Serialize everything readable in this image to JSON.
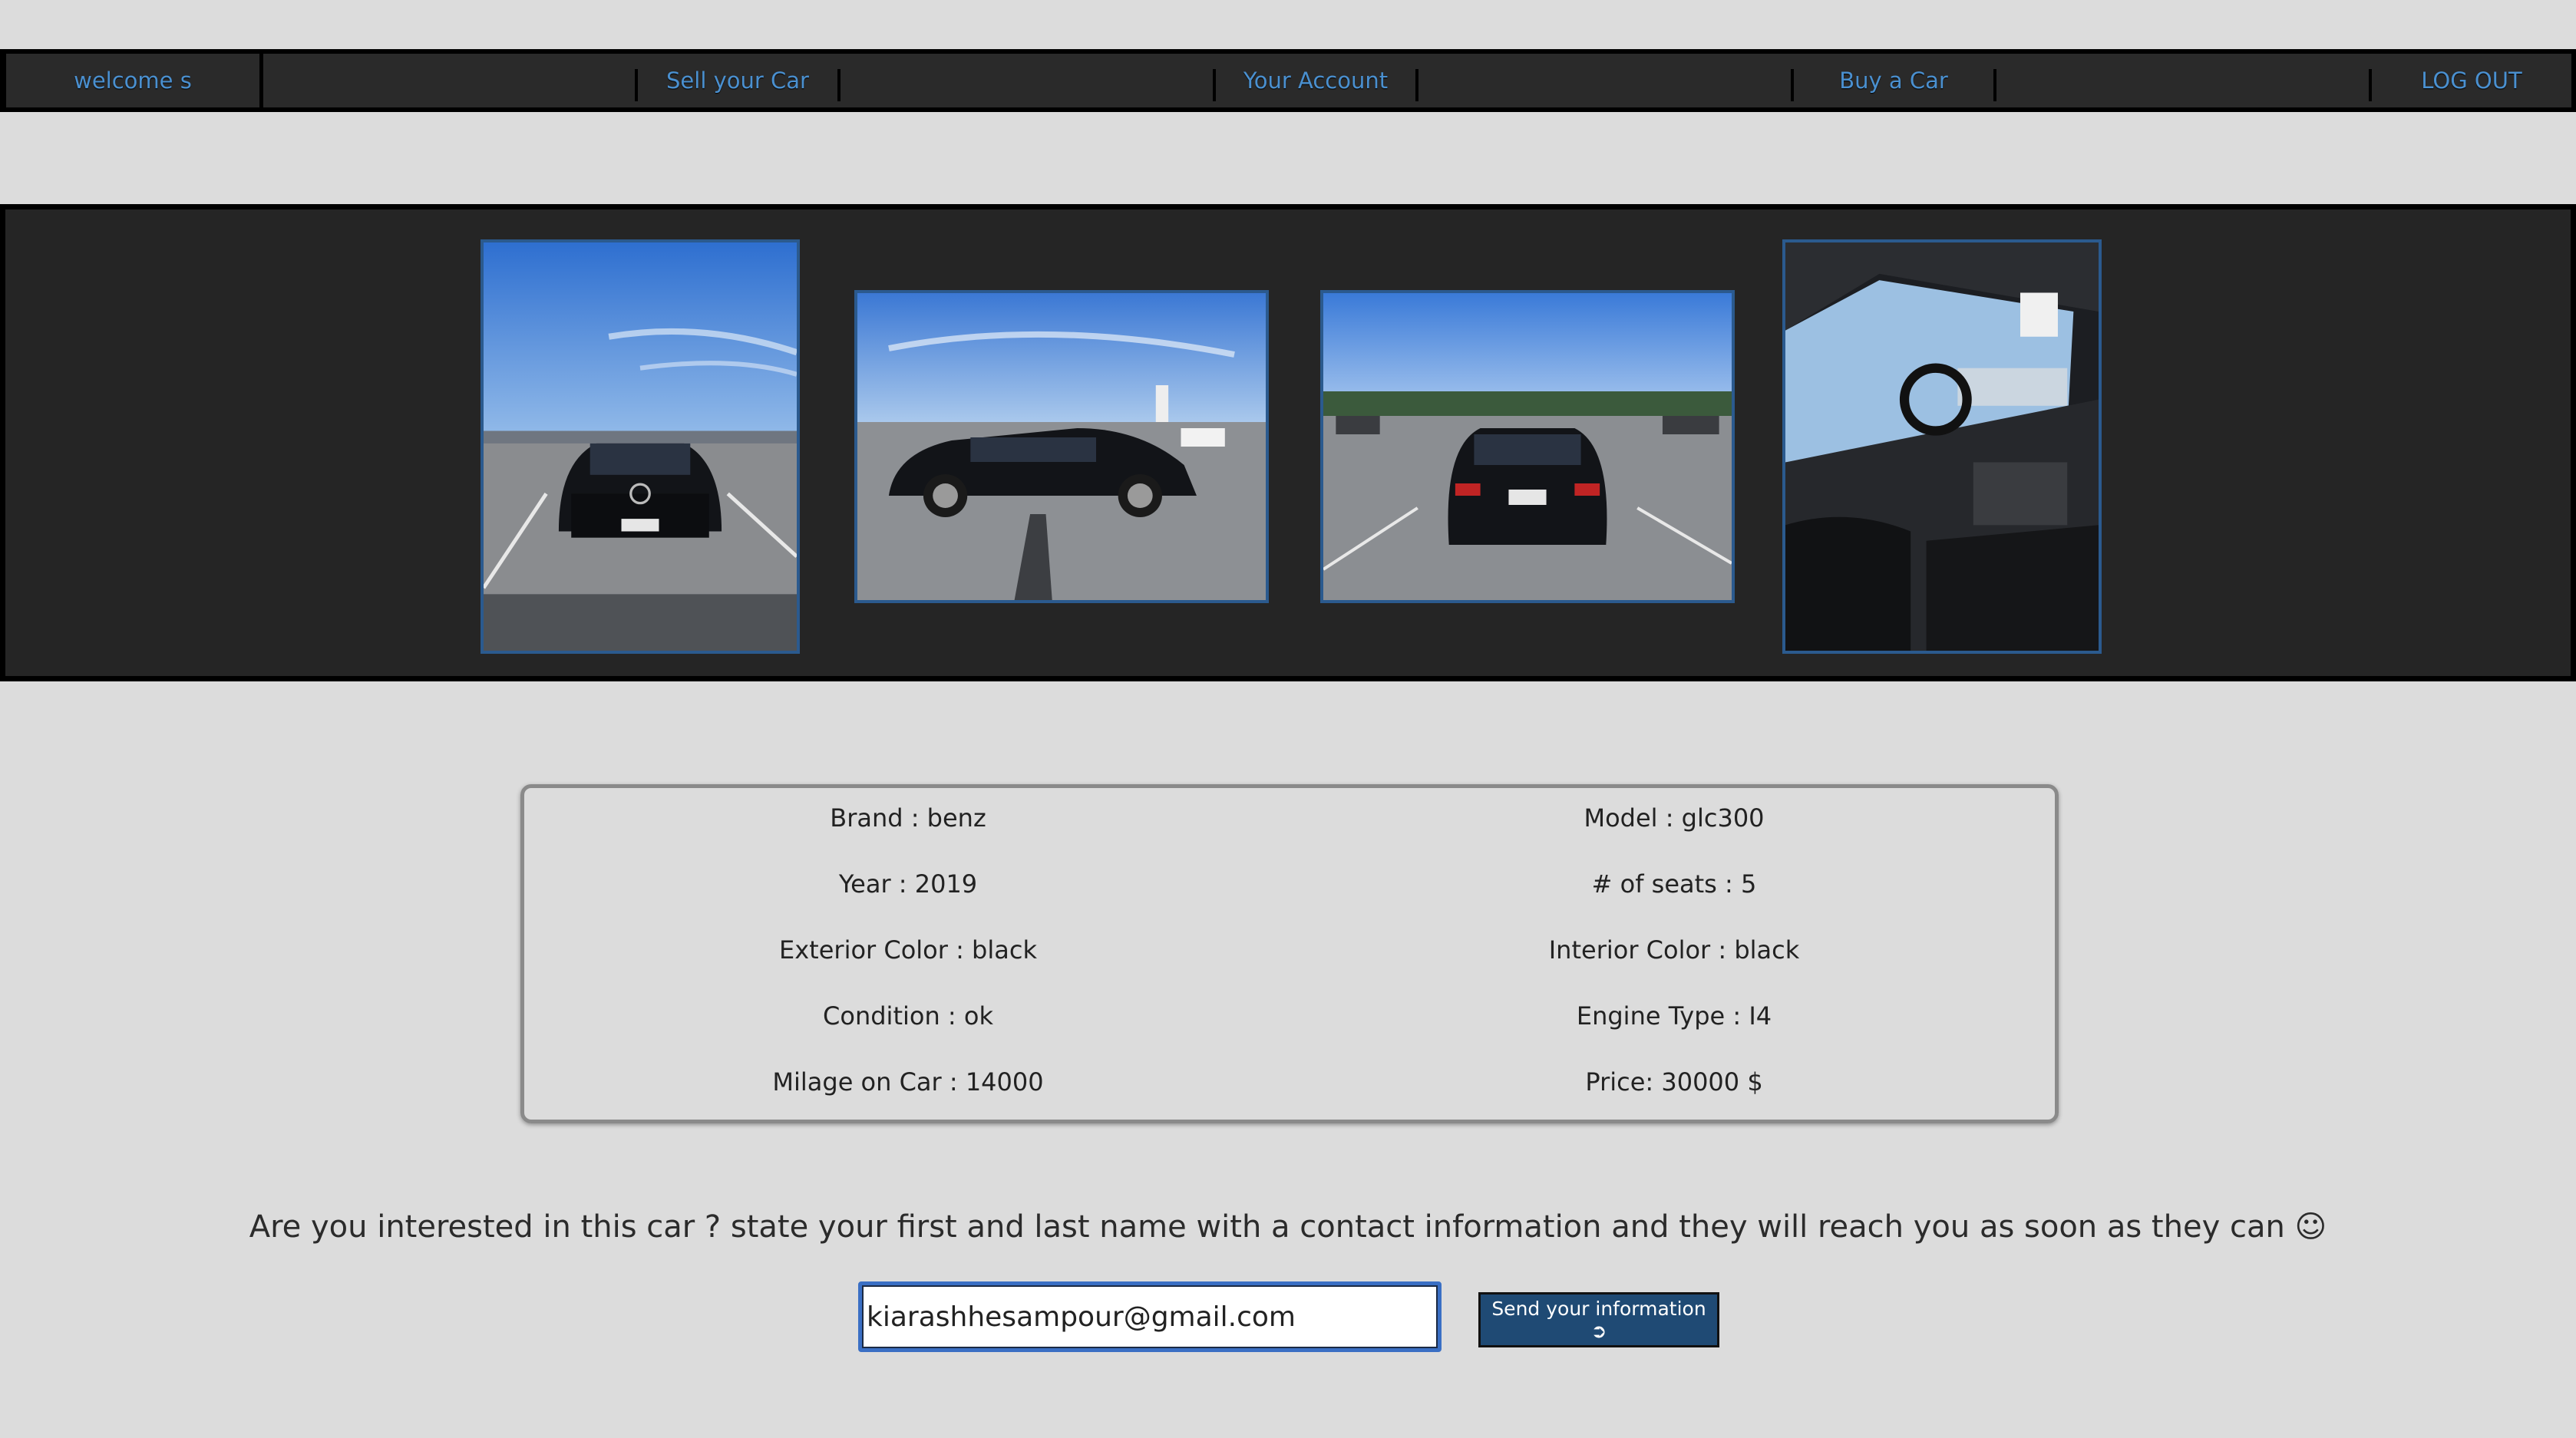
{
  "nav": {
    "welcome": "welcome s",
    "sell": "Sell your Car",
    "account": "Your Account",
    "buy": "Buy a Car",
    "logout": "LOG OUT"
  },
  "gallery": {
    "photos": [
      {
        "alt": "front view"
      },
      {
        "alt": "side view"
      },
      {
        "alt": "rear view"
      },
      {
        "alt": "interior view"
      }
    ]
  },
  "details": {
    "brand": "Brand : benz",
    "model": "Model : glc300",
    "year": "Year : 2019",
    "seats": "# of seats : 5",
    "exterior": "Exterior Color : black",
    "interior": "Interior Color : black",
    "condition": "Condition : ok",
    "engine": "Engine Type : I4",
    "milage": "Milage on Car : 14000",
    "price": "Price: 30000 $"
  },
  "contact": {
    "prompt": "Are you interested in this car ? state your first and last name with a contact information and they will reach you as soon as they can ☺",
    "input_value": "kiarashhesampour@gmail.com",
    "button_label": "Send your information ➲"
  },
  "colors": {
    "nav_text": "#4a90d0",
    "button_bg": "#1f4a74",
    "page_bg": "#dcdcdc"
  }
}
